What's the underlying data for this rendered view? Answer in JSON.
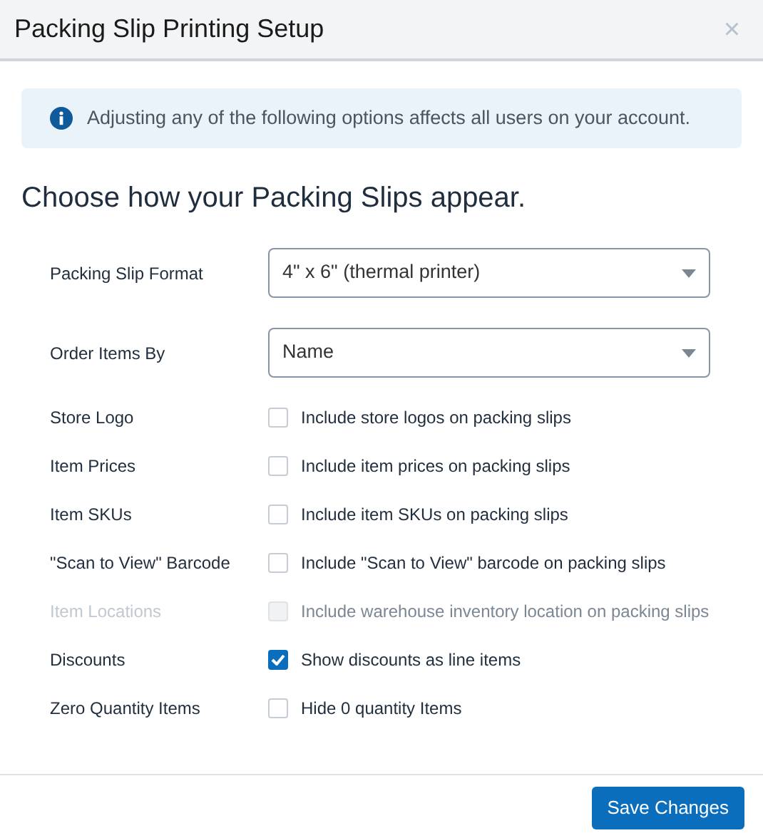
{
  "window": {
    "title": "Packing Slip Printing Setup",
    "close": "×"
  },
  "notice": "Adjusting any of the following options affects all users on your account.",
  "heading": "Choose how your Packing Slips appear.",
  "selects": [
    {
      "label": "Packing Slip Format",
      "value": "4\" x 6\" (thermal printer)"
    },
    {
      "label": "Order Items By",
      "value": "Name"
    }
  ],
  "options": [
    {
      "label": "Store Logo",
      "text": "Include store logos on packing slips",
      "checked": false,
      "disabled": false
    },
    {
      "label": "Item Prices",
      "text": "Include item prices on packing slips",
      "checked": false,
      "disabled": false
    },
    {
      "label": "Item SKUs",
      "text": "Include item SKUs on packing slips",
      "checked": false,
      "disabled": false
    },
    {
      "label": "\"Scan to View\" Barcode",
      "text": "Include \"Scan to View\" barcode on packing slips",
      "checked": false,
      "disabled": false
    },
    {
      "label": "Item Locations",
      "text": "Include warehouse inventory location on packing slips",
      "checked": false,
      "disabled": true
    },
    {
      "label": "Discounts",
      "text": "Show discounts as line items",
      "checked": true,
      "disabled": false
    },
    {
      "label": "Zero Quantity Items",
      "text": "Hide 0 quantity Items",
      "checked": false,
      "disabled": false
    }
  ],
  "buttons": [
    {
      "label": "Save Changes"
    }
  ]
}
